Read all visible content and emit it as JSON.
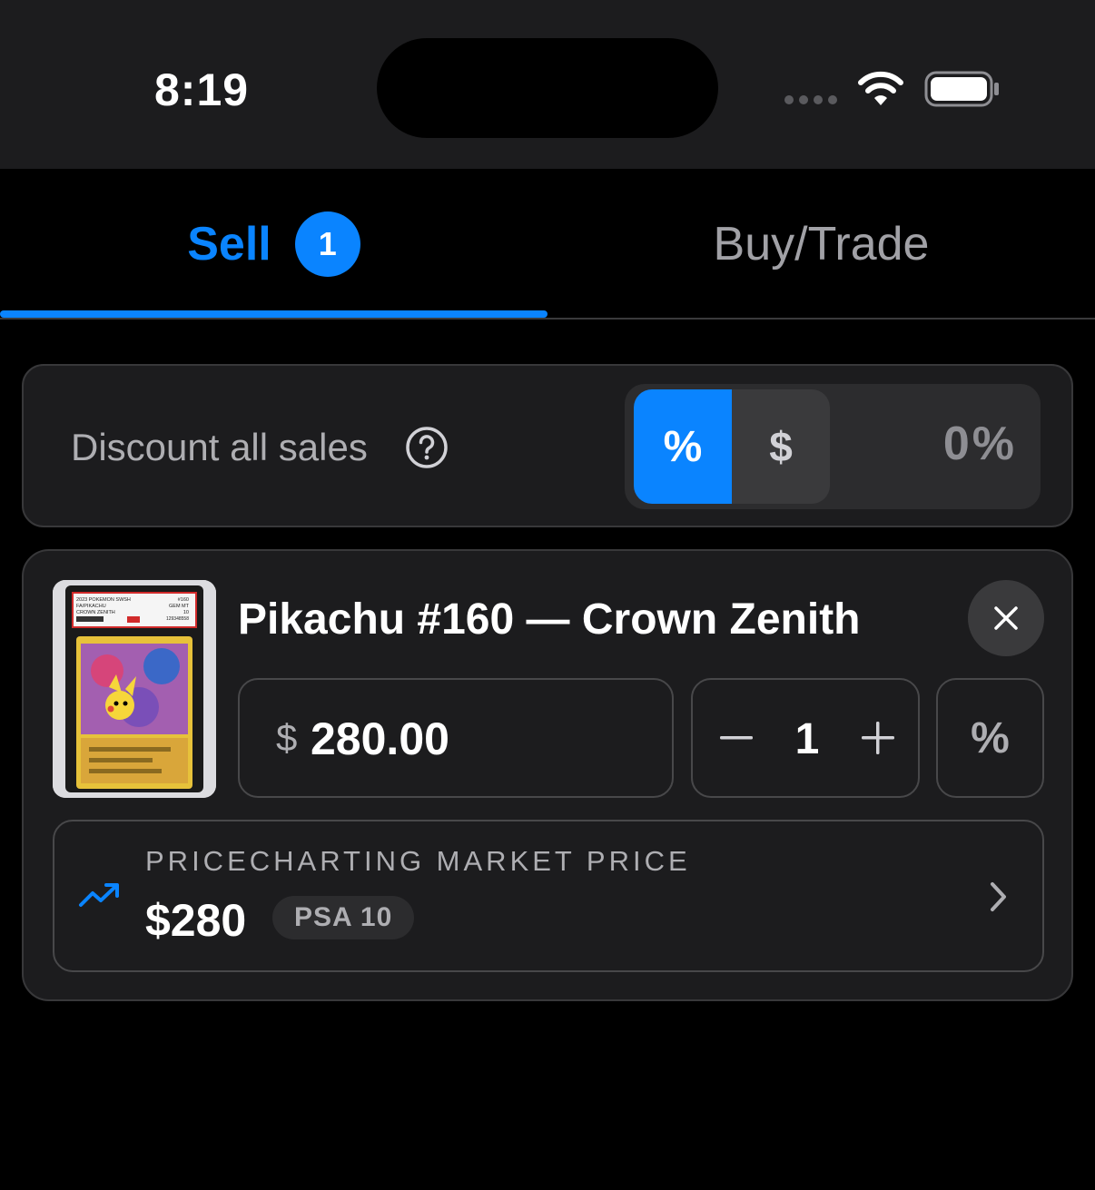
{
  "status_bar": {
    "time": "8:19"
  },
  "tabs": {
    "sell": {
      "label": "Sell",
      "badge": "1"
    },
    "buy": {
      "label": "Buy/Trade"
    }
  },
  "discount": {
    "label": "Discount all sales",
    "mode_percent": "%",
    "mode_dollar": "$",
    "value": "0%",
    "selected_mode": "percent"
  },
  "item": {
    "title": "Pikachu #160 — Crown Zenith",
    "currency": "$",
    "price": "280.00",
    "quantity": "1",
    "percent_toggle": "%",
    "market": {
      "label": "PRICECHARTING MARKET PRICE",
      "price": "$280",
      "grade": "PSA 10"
    },
    "slab_label": {
      "line1": "2023 POKEMON SWSH",
      "line2": "FA/PIKACHU",
      "line3": "CROWN ZENITH",
      "number": "#160",
      "grade_text": "GEM MT",
      "grade_num": "10",
      "cert": "129348558"
    }
  },
  "colors": {
    "accent": "#0a84ff",
    "background": "#000000",
    "card": "#1c1c1e",
    "border": "#38383a"
  },
  "icons": {
    "help": "question-circle-icon",
    "close": "close-icon",
    "minus": "minus-icon",
    "plus": "plus-icon",
    "trend": "trending-up-icon",
    "chevron": "chevron-right-icon"
  }
}
